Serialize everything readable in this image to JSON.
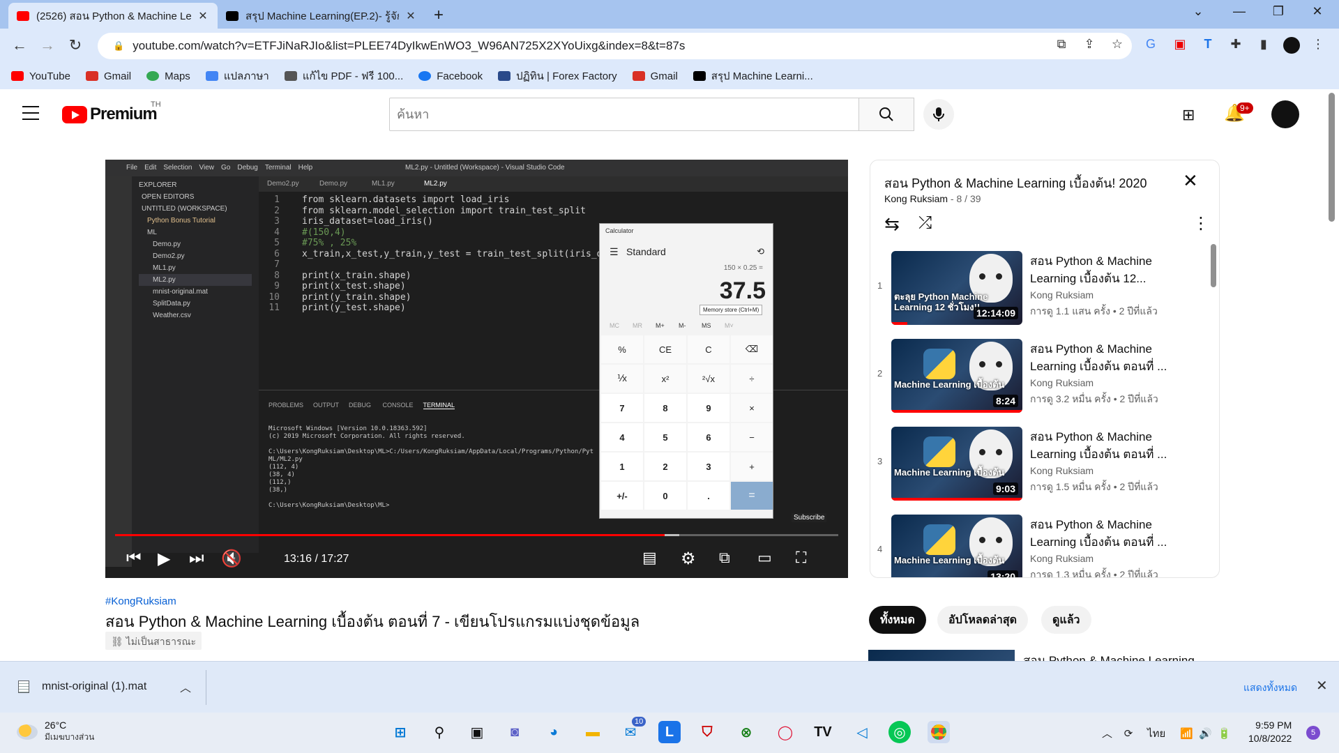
{
  "browser": {
    "tabs": [
      {
        "title": "(2526) สอน Python & Machine Le",
        "active": true,
        "favicon": "youtube-icon"
      },
      {
        "title": "สรุป Machine Learning(EP.2)- รู้จัก",
        "active": false,
        "favicon": "medium-icon"
      }
    ],
    "url": "youtube.com/watch?v=ETFJiNaRJIo&list=PLEE74DyIkwEnWO3_W96AN725X2XYoUixg&index=8&t=87s",
    "bookmarks": [
      {
        "label": "YouTube",
        "icon": "youtube-icon",
        "color": "#ff0000"
      },
      {
        "label": "Gmail",
        "icon": "gmail-icon",
        "color": "#d93025"
      },
      {
        "label": "Maps",
        "icon": "maps-icon",
        "color": "#34a853"
      },
      {
        "label": "แปลภาษา",
        "icon": "translate-icon",
        "color": "#4285f4"
      },
      {
        "label": "แก้ไข PDF - ฟรี 100...",
        "icon": "pdf-icon",
        "color": "#555555"
      },
      {
        "label": "Facebook",
        "icon": "facebook-icon",
        "color": "#1877f2"
      },
      {
        "label": "ปฏิทิน | Forex Factory",
        "icon": "forex-icon",
        "color": "#2a4a8a"
      },
      {
        "label": "Gmail",
        "icon": "gmail-icon",
        "color": "#d93025"
      },
      {
        "label": "สรุป Machine Learni...",
        "icon": "medium-icon",
        "color": "#000000"
      }
    ]
  },
  "youtube": {
    "logo_text": "Premium",
    "country": "TH",
    "search_placeholder": "ค้นหา",
    "notification_count": "9+"
  },
  "video": {
    "time": "13:16 / 17:27",
    "progress": 0.76,
    "hashtag": "#KongRuksiam",
    "title": "สอน Python & Machine Learning เบื้องต้น ตอนที่ 7 - เขียนโปรแกรมแบ่งชุดข้อมูล",
    "visibility": "ไม่เป็นสาธารณะ",
    "subscribe_label": "Subscribe",
    "frame": {
      "vscode_title": "ML2.py - Untitled (Workspace) - Visual Studio Code",
      "menu": [
        "File",
        "Edit",
        "Selection",
        "View",
        "Go",
        "Debug",
        "Terminal",
        "Help"
      ],
      "explorer_label": "EXPLORER",
      "explorer_items": [
        "OPEN EDITORS",
        "UNTITLED (WORKSPACE)",
        "Python Bonus Tutorial",
        "ML",
        "Demo.py",
        "Demo2.py",
        "ML1.py",
        "ML2.py",
        "mnist-original.mat",
        "SplitData.py",
        "Weather.csv"
      ],
      "editor_tabs": [
        "Demo2.py",
        "Demo.py",
        "ML1.py",
        "ML2.py"
      ],
      "code_lines": [
        "from sklearn.datasets import load_iris",
        "from sklearn.model_selection import train_test_split",
        "iris_dataset=load_iris()",
        "#(150,4)",
        "#75% , 25%",
        "x_train,x_test,y_train,y_test = train_test_split(iris_d",
        "",
        "print(x_train.shape)",
        "print(x_test.shape)",
        "print(y_train.shape)",
        "print(y_test.shape)"
      ],
      "panel_tabs": [
        "PROBLEMS",
        "OUTPUT",
        "DEBUG CONSOLE",
        "TERMINAL"
      ],
      "terminal_lines": [
        "Microsoft Windows [Version 10.0.18363.592]",
        "(c) 2019 Microsoft Corporation. All rights reserved.",
        "",
        "C:\\Users\\KongRuksiam\\Desktop\\ML>C:/Users/KongRuksiam/AppData/Local/Programs/Python/Pyt",
        "ML/ML2.py",
        "(112, 4)",
        "(38, 4)",
        "(112,)",
        "(38,)",
        "",
        "C:\\Users\\KongRuksiam\\Desktop\\ML>"
      ],
      "calculator": {
        "title": "Calculator",
        "mode": "Standard",
        "expression": "150 × 0.25 =",
        "result": "37.5",
        "tooltip": "Memory store (Ctrl+M)",
        "memory": [
          "MC",
          "MR",
          "M+",
          "M-",
          "MS",
          "M˅"
        ],
        "keys": [
          "%",
          "CE",
          "C",
          "⌫",
          "⅟x",
          "x²",
          "²√x",
          "÷",
          "7",
          "8",
          "9",
          "×",
          "4",
          "5",
          "6",
          "−",
          "1",
          "2",
          "3",
          "+",
          "+/-",
          "0",
          ".",
          "="
        ]
      }
    }
  },
  "playlist": {
    "title": "สอน Python & Machine Learning เบื้องต้น! 2020",
    "channel": "Kong Ruksiam",
    "position": "8 / 39",
    "items": [
      {
        "index": "1",
        "title": "สอน Python & Machine Learning เบื้องต้น 12...",
        "channel": "Kong Ruksiam",
        "views": "การดู 1.1 แสน ครั้ง • 2 ปีที่แล้ว",
        "duration": "12:14:09",
        "thumb_text": "ตะลุย Python Machine Learning 12 ชั่วโมง!!"
      },
      {
        "index": "2",
        "title": "สอน Python & Machine Learning เบื้องต้น ตอนที่ ...",
        "channel": "Kong Ruksiam",
        "views": "การดู 3.2 หมื่น ครั้ง • 2 ปีที่แล้ว",
        "duration": "8:24",
        "thumb_text": "Machine Learning เบื้องต้น"
      },
      {
        "index": "3",
        "title": "สอน Python & Machine Learning เบื้องต้น ตอนที่ ...",
        "channel": "Kong Ruksiam",
        "views": "การดู 1.5 หมื่น ครั้ง • 2 ปีที่แล้ว",
        "duration": "9:03",
        "thumb_text": "Machine Learning เบื้องต้น"
      },
      {
        "index": "4",
        "title": "สอน Python & Machine Learning เบื้องต้น ตอนที่ ...",
        "channel": "Kong Ruksiam",
        "views": "การดู 1.3 หมื่น ครั้ง • 2 ปีที่แล้ว",
        "duration": "13:20",
        "thumb_text": "Machine Learning เบื้องต้น"
      }
    ]
  },
  "chips": [
    "ทั้งหมด",
    "อัปโหลดล่าสุด",
    "ดูแล้ว"
  ],
  "next_video_title": "สอน Python & Machine Learning",
  "download": {
    "filename": "mnist-original (1).mat",
    "show_all": "แสดงทั้งหมด"
  },
  "taskbar": {
    "temperature": "26°C",
    "weather": "มีเมฆบางส่วน",
    "mail_badge": "10",
    "language": "ไทย",
    "time": "9:59 PM",
    "date": "10/8/2022",
    "notifications": "5"
  }
}
